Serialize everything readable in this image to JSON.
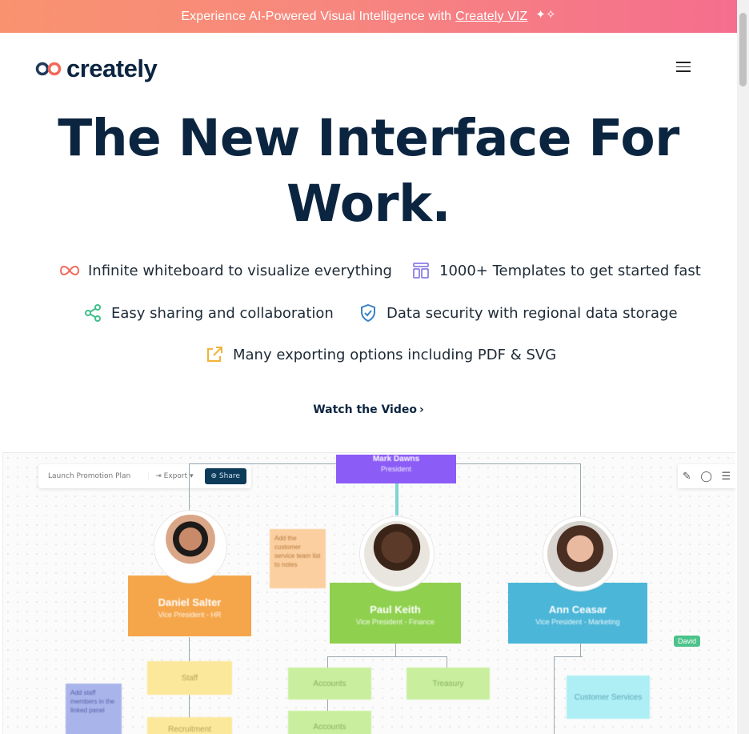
{
  "promo": {
    "text": "Experience AI-Powered Visual Intelligence with",
    "link": "Creately VIZ",
    "sparkle": "✦✧"
  },
  "header": {
    "brand": "creately",
    "menu_icon": "hamburger-icon"
  },
  "hero": {
    "title_line1": "The New Interface For",
    "title_line2": "Work.",
    "features": [
      {
        "icon": "infinity-icon",
        "text": "Infinite whiteboard to visualize everything"
      },
      {
        "icon": "template-icon",
        "text": "1000+ Templates to get started fast"
      },
      {
        "icon": "share-icon",
        "text": "Easy sharing and collaboration"
      },
      {
        "icon": "shield-icon",
        "text": "Data security with regional data storage"
      },
      {
        "icon": "export-icon",
        "text": "Many exporting options including PDF & SVG"
      }
    ],
    "watch_label": "Watch the Video",
    "watch_chevron": "›"
  },
  "canvas": {
    "doc_title": "Launch Promotion Plan",
    "export_label": "Export",
    "share_label": "Share",
    "top_card": {
      "name": "Mark Dawns",
      "role": "President"
    },
    "cards": [
      {
        "name": "Daniel Salter",
        "role": "Vice President - HR"
      },
      {
        "name": "Paul Keith",
        "role": "Vice President - Finance"
      },
      {
        "name": "Ann Ceasar",
        "role": "Vice President - Marketing"
      }
    ],
    "boxes": {
      "staff": "Staff",
      "recruitment": "Recruitment",
      "accounts1": "Accounts",
      "accounts2": "Accounts",
      "treasury": "Treasury",
      "customer_services": "Customer Services"
    },
    "notes": {
      "orange": "Add the customer service team list to notes",
      "blue": "Add staff members in the linked panel"
    },
    "cursor_name": "David",
    "colors": {
      "purple": "#8b5cf6",
      "orange": "#f5a64b",
      "green": "#8fd14f",
      "blue": "#4bb6d8"
    }
  }
}
